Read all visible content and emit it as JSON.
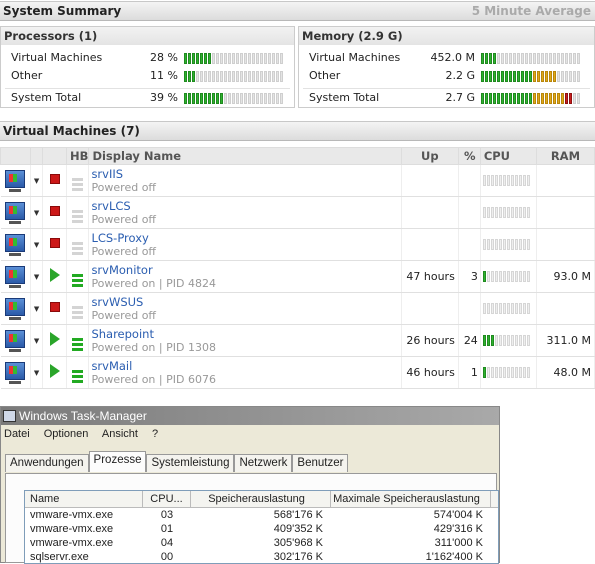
{
  "summary": {
    "title": "System Summary",
    "average_label": "5 Minute Average",
    "processors": {
      "heading": "Processors (1)",
      "rows": [
        {
          "label": "Virtual Machines",
          "value": "28 %",
          "level": 0.28
        },
        {
          "label": "Other",
          "value": "11 %",
          "level": 0.11
        },
        {
          "label": "System Total",
          "value": "39 %",
          "level": 0.39
        }
      ]
    },
    "memory": {
      "heading": "Memory (2.9 G)",
      "rows": [
        {
          "label": "Virtual Machines",
          "value": "452.0 M",
          "level": 0.15
        },
        {
          "label": "Other",
          "value": "2.2 G",
          "level": 0.76
        },
        {
          "label": "System Total",
          "value": "2.7 G",
          "level": 0.93
        }
      ]
    }
  },
  "vms": {
    "title": "Virtual Machines (7)",
    "columns": {
      "hb": "HB",
      "name": "Display Name",
      "up": "Up",
      "pct": "%",
      "cpu": "CPU",
      "ram": "RAM"
    },
    "rows": [
      {
        "name": "srvIIS",
        "status": "Powered off",
        "running": false,
        "up": "",
        "pct": "",
        "cpu_level": 0,
        "ram": ""
      },
      {
        "name": "srvLCS",
        "status": "Powered off",
        "running": false,
        "up": "",
        "pct": "",
        "cpu_level": 0,
        "ram": ""
      },
      {
        "name": "LCS-Proxy",
        "status": "Powered off",
        "running": false,
        "up": "",
        "pct": "",
        "cpu_level": 0,
        "ram": ""
      },
      {
        "name": "srvMonitor",
        "status": "Powered on | PID 4824",
        "running": true,
        "up": "47 hours",
        "pct": "3",
        "cpu_level": 0.03,
        "ram": "93.0 M"
      },
      {
        "name": "srvWSUS",
        "status": "Powered off",
        "running": false,
        "up": "",
        "pct": "",
        "cpu_level": 0,
        "ram": ""
      },
      {
        "name": "Sharepoint",
        "status": "Powered on | PID 1308",
        "running": true,
        "up": "26 hours",
        "pct": "24",
        "cpu_level": 0.24,
        "ram": "311.0 M"
      },
      {
        "name": "srvMail",
        "status": "Powered on | PID 6076",
        "running": true,
        "up": "46 hours",
        "pct": "1",
        "cpu_level": 0.01,
        "ram": "48.0 M"
      }
    ]
  },
  "taskmanager": {
    "title": "Windows Task-Manager",
    "menu": [
      "Datei",
      "Optionen",
      "Ansicht",
      "?"
    ],
    "tabs": [
      "Anwendungen",
      "Prozesse",
      "Systemleistung",
      "Netzwerk",
      "Benutzer"
    ],
    "active_tab": 1,
    "columns": [
      "Name",
      "CPU...",
      "Speicherauslastung",
      "Maximale Speicherauslastung"
    ],
    "rows": [
      [
        "vmware-vmx.exe",
        "03",
        "568'176 K",
        "574'004 K"
      ],
      [
        "vmware-vmx.exe",
        "01",
        "409'352 K",
        "429'316 K"
      ],
      [
        "vmware-vmx.exe",
        "04",
        "305'968 K",
        "311'000 K"
      ],
      [
        "sqlservr.exe",
        "00",
        "302'176 K",
        "1'162'400 K"
      ]
    ]
  }
}
